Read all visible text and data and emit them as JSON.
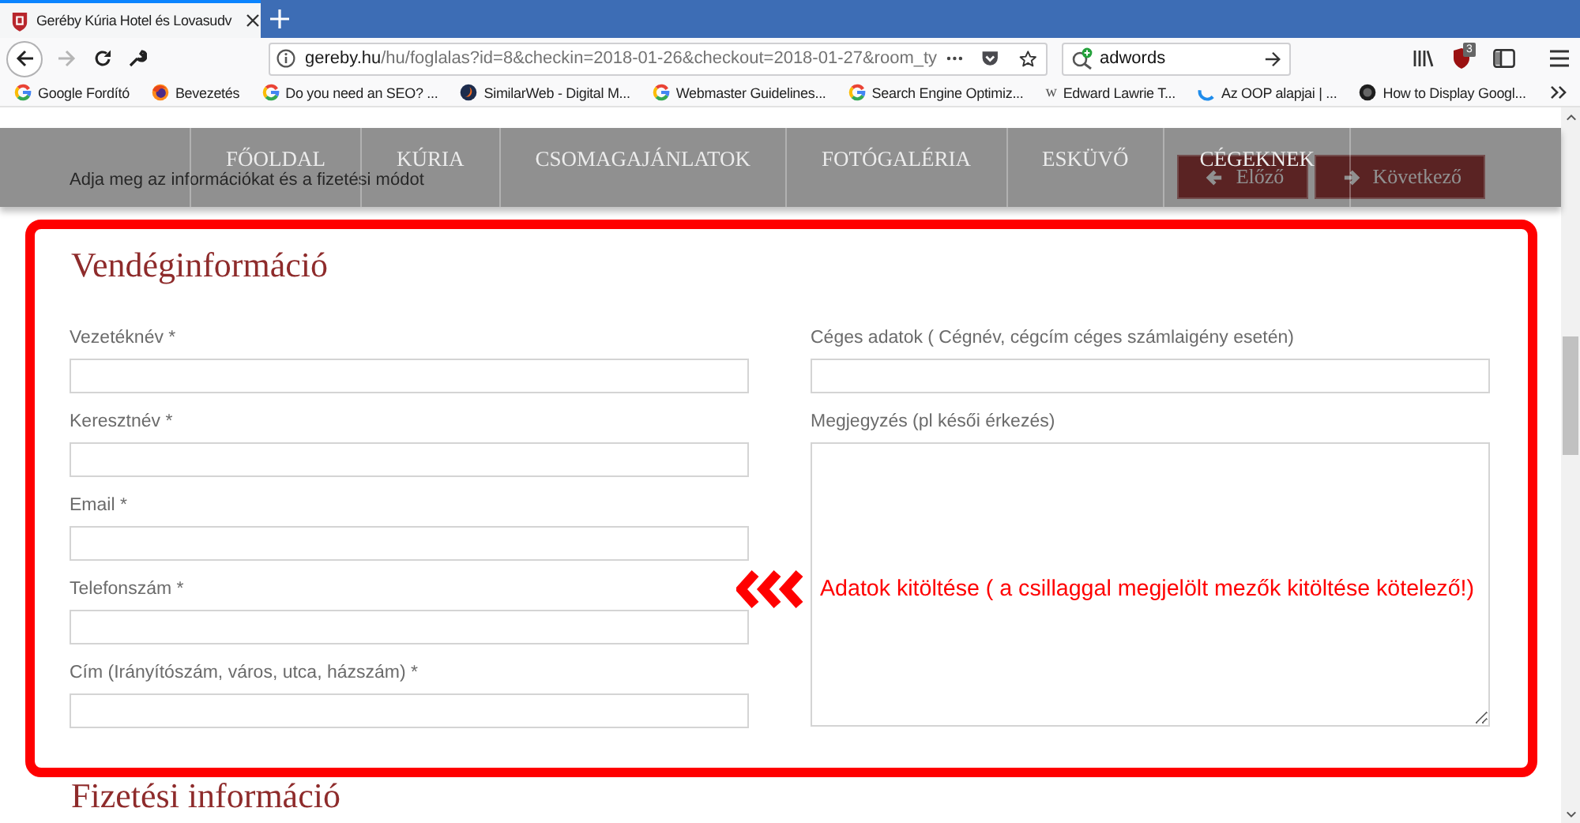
{
  "browser": {
    "tabs": [
      {
        "title": "Geréby Kúria Hotel és Lovasudv",
        "selected": true
      }
    ],
    "forward": {
      "disabled": true
    },
    "address": {
      "host": "gereby.hu",
      "path": "/hu/foglalas?id=8&checkin=2018-01-26&checkout=2018-01-27&room_ty"
    },
    "search": {
      "value": "adwords"
    },
    "extension_badge": "3",
    "bookmarks": [
      {
        "label": "Google Fordító",
        "kind": "g"
      },
      {
        "label": "Bevezetés",
        "kind": "firefox"
      },
      {
        "label": "Do you need an SEO? ...",
        "kind": "g"
      },
      {
        "label": "SimilarWeb - Digital M...",
        "kind": "similarweb"
      },
      {
        "label": "Webmaster Guidelines...",
        "kind": "g"
      },
      {
        "label": "Search Engine Optimiz...",
        "kind": "g"
      },
      {
        "label": "Edward Lawrie T...",
        "kind": "glyph",
        "glyph": "w"
      },
      {
        "label": "Az OOP alapjai | ...",
        "kind": "arc"
      },
      {
        "label": "How to Display Googl...",
        "kind": "disc"
      }
    ]
  },
  "nav": {
    "items": [
      "FŐOLDAL",
      "KÚRIA",
      "CSOMAGAJÁNLATOK",
      "FOTÓGALÉRIA",
      "ESKÜVŐ",
      "CÉGEKNEK"
    ]
  },
  "page": {
    "subtitle": "Adja meg az információkat és a fizetési módot",
    "buttons": [
      {
        "label": "Előző",
        "kind": "prev"
      },
      {
        "label": "Következő",
        "kind": "next"
      }
    ]
  },
  "guest_info": {
    "title": "Vendéginformáció",
    "left_fields": [
      {
        "label": "Vezetéknév *",
        "kind": "input"
      },
      {
        "label": "Keresztnév *",
        "kind": "input"
      },
      {
        "label": "Email *",
        "kind": "input"
      },
      {
        "label": "Telefonszám *",
        "kind": "input"
      },
      {
        "label": "Cím (Irányítószám, város, utca, házszám) *",
        "kind": "input"
      }
    ],
    "right_fields": [
      {
        "label": "Céges adatok ( Cégnév, cégcím céges számlaigény esetén)",
        "kind": "input"
      },
      {
        "label": "Megjegyzés (pl késői érkezés)",
        "kind": "textarea"
      }
    ]
  },
  "annotation": {
    "text": "Adatok kitöltése ( a csillaggal megjelölt mezők kitöltése kötelező!)"
  },
  "payment_info": {
    "title": "Fizetési információ"
  }
}
